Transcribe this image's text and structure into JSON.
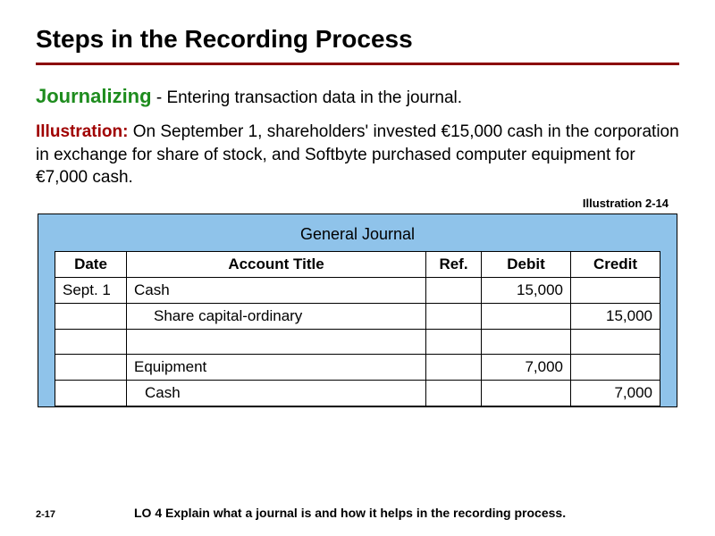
{
  "title": "Steps in the Recording Process",
  "sub_term": "Journalizing",
  "sub_def": " - Entering transaction data in the journal.",
  "illus_label": "Illustration:",
  "illus_text": "  On September 1, shareholders' invested €15,000 cash in the corporation in exchange for share of stock, and Softbyte purchased computer equipment for €7,000 cash.",
  "illus_ref": "Illustration 2-14",
  "journal_title": "General Journal",
  "headers": {
    "date": "Date",
    "title": "Account Title",
    "ref": "Ref.",
    "debit": "Debit",
    "credit": "Credit"
  },
  "rows": [
    {
      "date": "Sept. 1",
      "title": "Cash",
      "indent": "",
      "ref": "",
      "debit": "15,000",
      "credit": ""
    },
    {
      "date": "",
      "title": "Share capital-ordinary",
      "indent": "indent1",
      "ref": "",
      "debit": "",
      "credit": "15,000"
    },
    {
      "date": "",
      "title": "",
      "indent": "",
      "ref": "",
      "debit": "",
      "credit": ""
    },
    {
      "date": "",
      "title": "Equipment",
      "indent": "",
      "ref": "",
      "debit": "7,000",
      "credit": ""
    },
    {
      "date": "",
      "title": "Cash",
      "indent": "indent2",
      "ref": "",
      "debit": "",
      "credit": "7,000"
    }
  ],
  "slide_num": "2-17",
  "lo": "LO 4  Explain what a journal is and how it helps in the recording process.",
  "chart_data": {
    "type": "table",
    "title": "General Journal",
    "columns": [
      "Date",
      "Account Title",
      "Ref.",
      "Debit",
      "Credit"
    ],
    "rows": [
      [
        "Sept. 1",
        "Cash",
        "",
        15000,
        null
      ],
      [
        "",
        "Share capital-ordinary",
        "",
        null,
        15000
      ],
      [
        "",
        "",
        "",
        null,
        null
      ],
      [
        "",
        "Equipment",
        "",
        7000,
        null
      ],
      [
        "",
        "Cash",
        "",
        null,
        7000
      ]
    ]
  }
}
